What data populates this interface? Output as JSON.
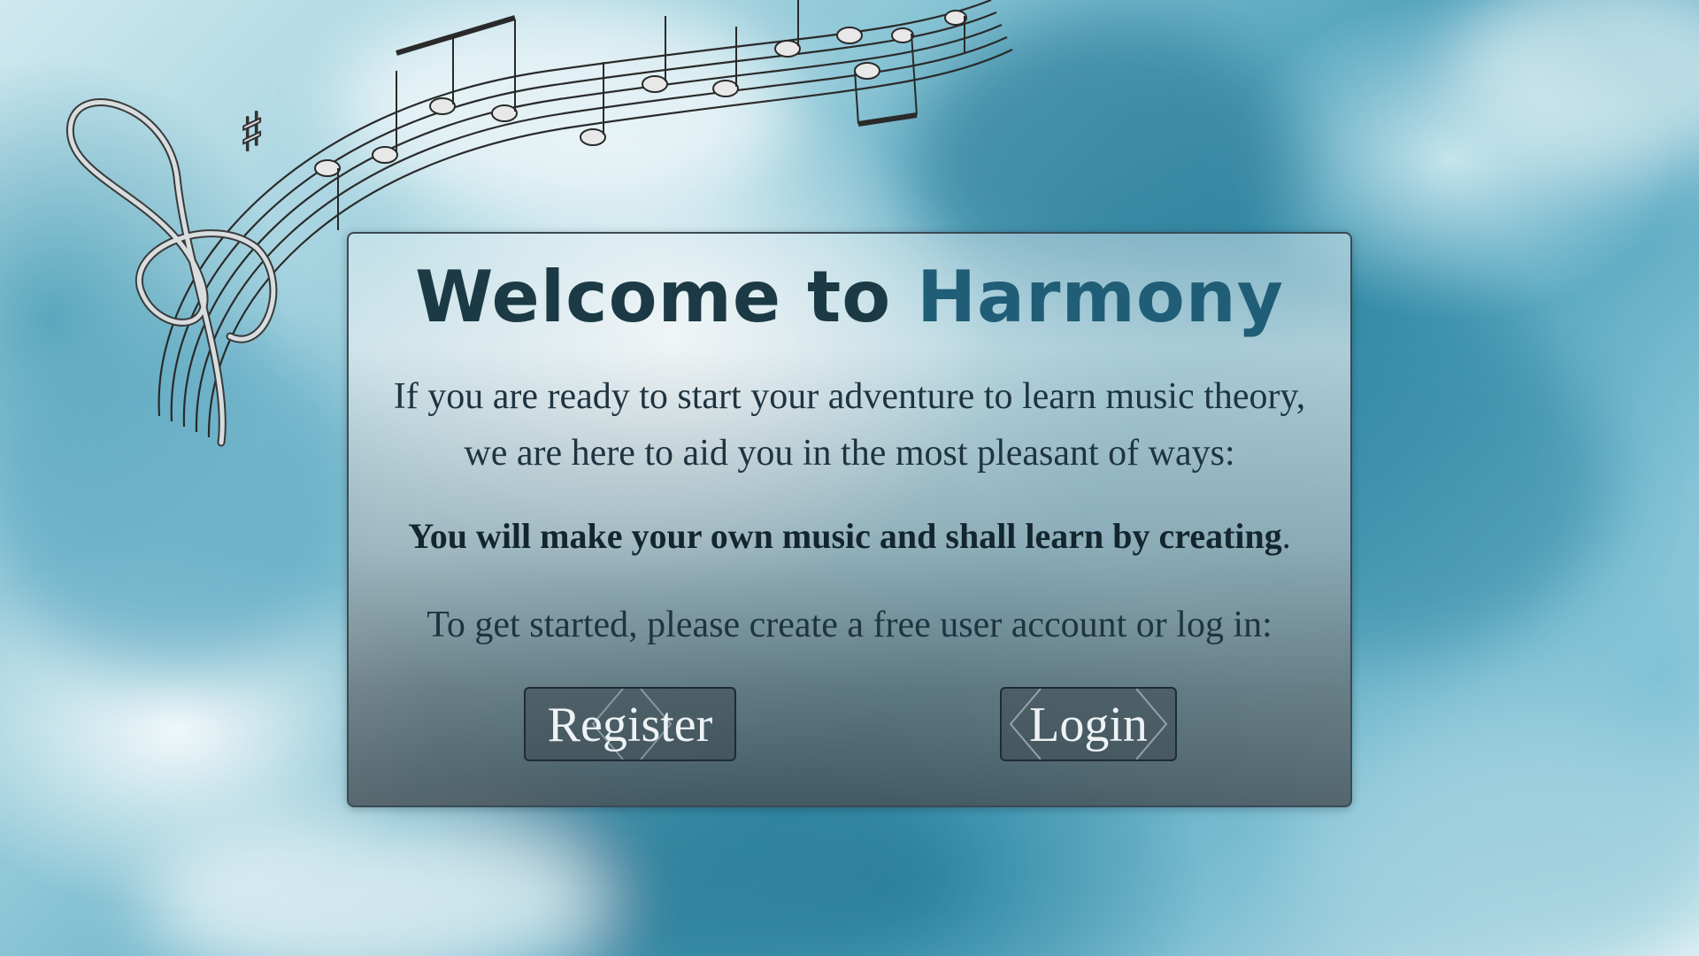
{
  "welcome": {
    "title_part1": "Welcome to",
    "title_part2": "Harmony",
    "intro_line1": "If you are ready to start your adventure to learn music theory,",
    "intro_line2": "we are here to aid you in the most pleasant of ways:",
    "bold_statement": "You will make your own music and shall learn by creating",
    "bold_suffix": ".",
    "get_started": "To get started, please create a free user account or log in:"
  },
  "buttons": {
    "register_label": "Register",
    "login_label": "Login"
  },
  "icons": {
    "decoration": "music-staff-icon",
    "clef": "treble-clef-icon"
  },
  "colors": {
    "title_dark": "#1b3a45",
    "title_accent": "#1f5e76",
    "text": "#1e3440",
    "button_text": "#eef3f5"
  }
}
